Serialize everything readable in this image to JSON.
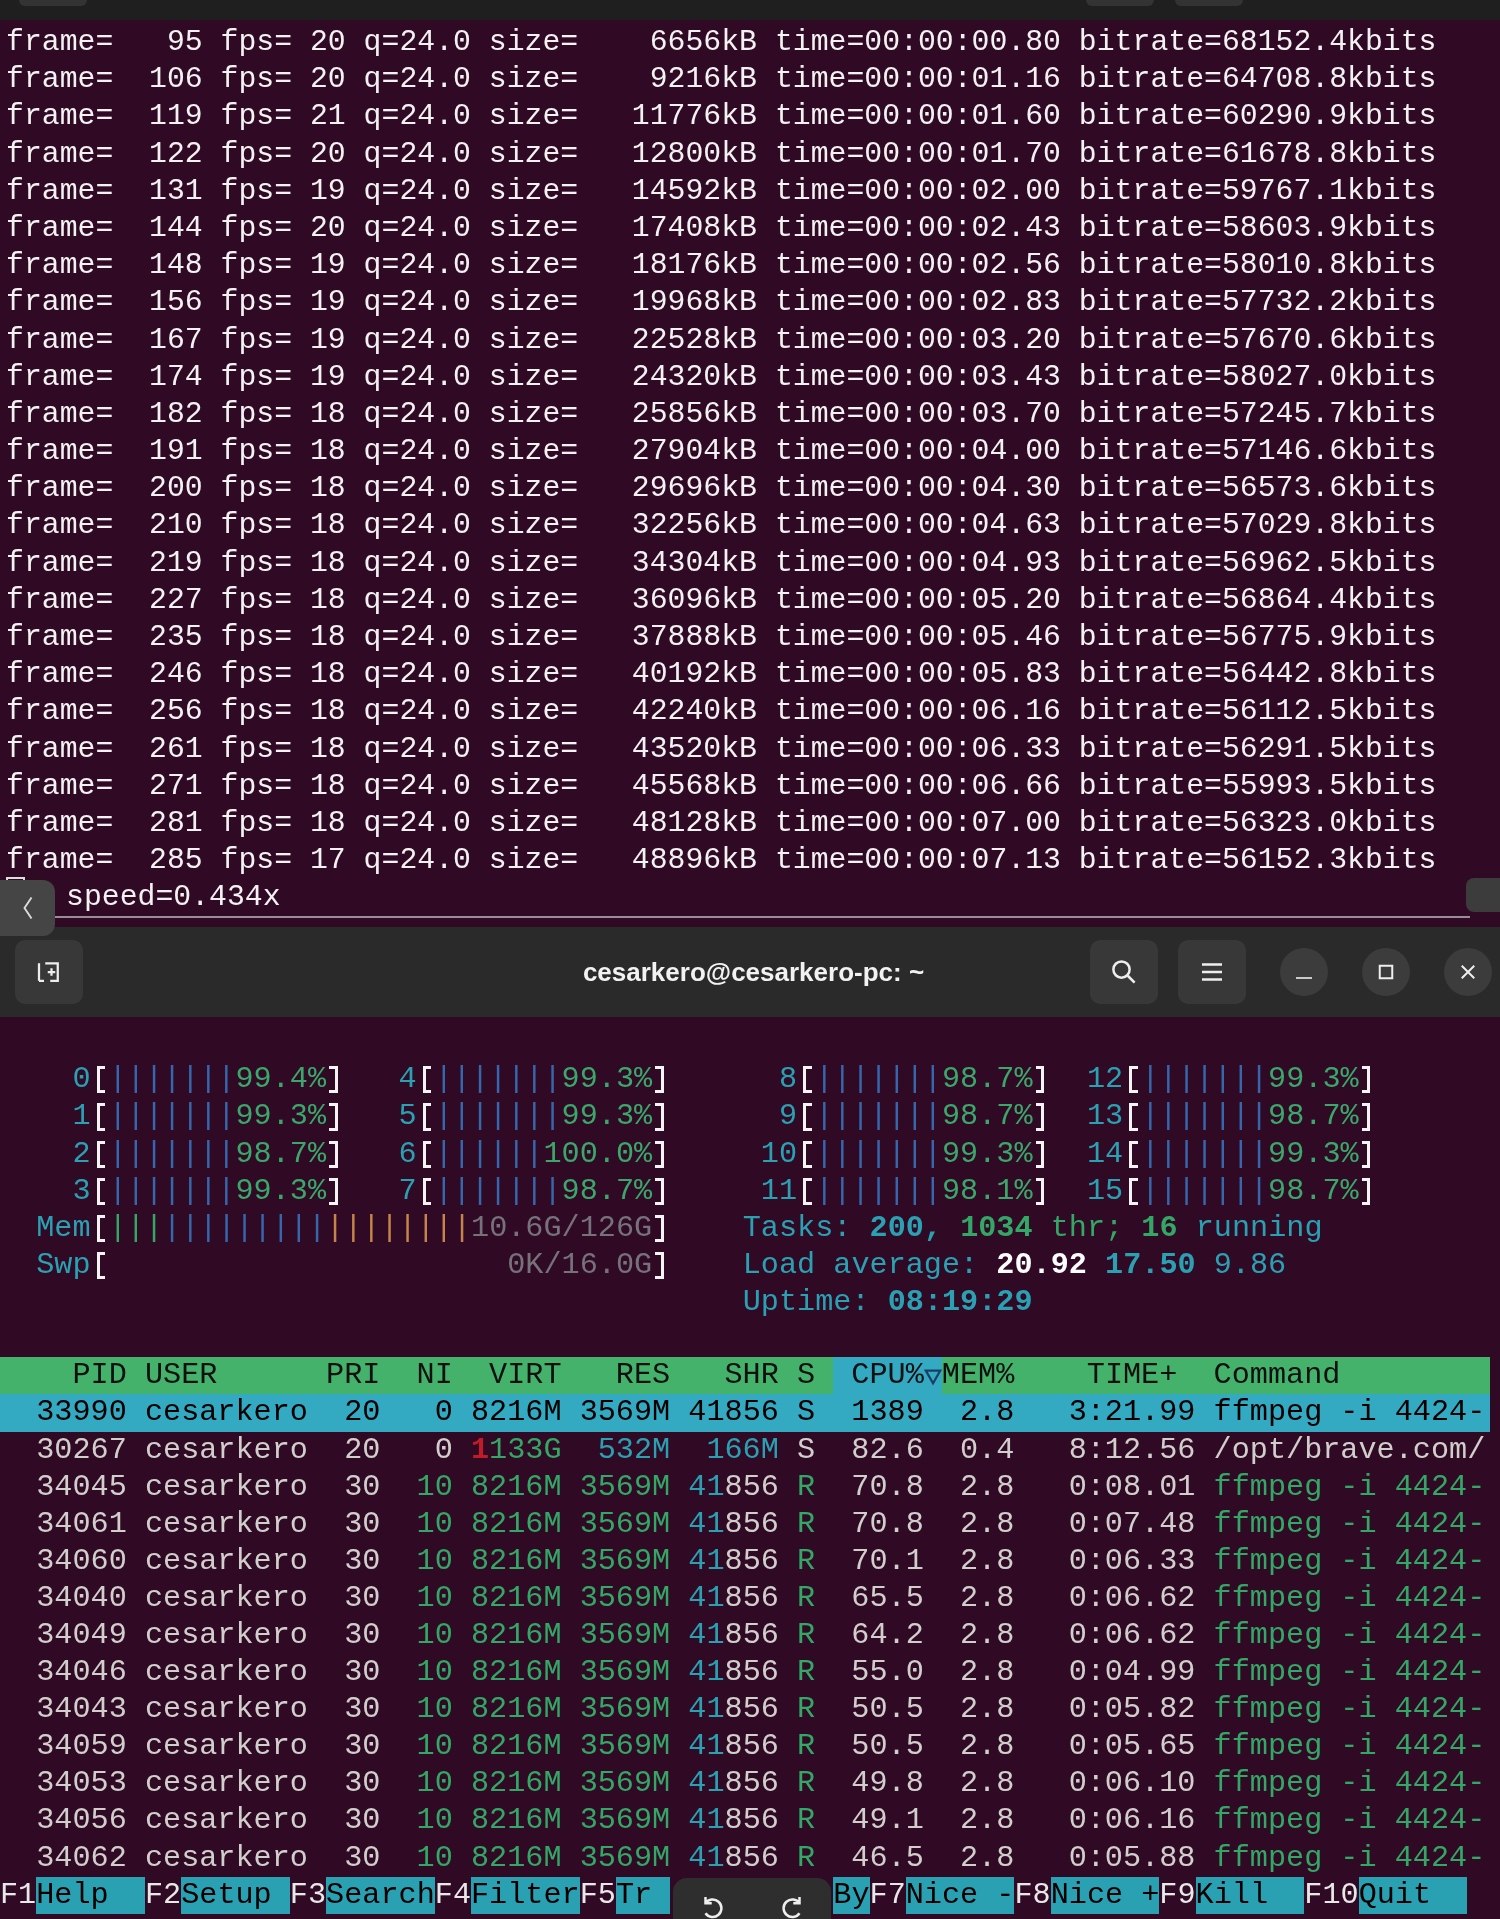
{
  "top_terminal": {
    "lines": [
      "frame=   95 fps= 20 q=24.0 size=    6656kB time=00:00:00.80 bitrate=68152.4kbits",
      "frame=  106 fps= 20 q=24.0 size=    9216kB time=00:00:01.16 bitrate=64708.8kbits",
      "frame=  119 fps= 21 q=24.0 size=   11776kB time=00:00:01.60 bitrate=60290.9kbits",
      "frame=  122 fps= 20 q=24.0 size=   12800kB time=00:00:01.70 bitrate=61678.8kbits",
      "frame=  131 fps= 19 q=24.0 size=   14592kB time=00:00:02.00 bitrate=59767.1kbits",
      "frame=  144 fps= 20 q=24.0 size=   17408kB time=00:00:02.43 bitrate=58603.9kbits",
      "frame=  148 fps= 19 q=24.0 size=   18176kB time=00:00:02.56 bitrate=58010.8kbits",
      "frame=  156 fps= 19 q=24.0 size=   19968kB time=00:00:02.83 bitrate=57732.2kbits",
      "frame=  167 fps= 19 q=24.0 size=   22528kB time=00:00:03.20 bitrate=57670.6kbits",
      "frame=  174 fps= 19 q=24.0 size=   24320kB time=00:00:03.43 bitrate=58027.0kbits",
      "frame=  182 fps= 18 q=24.0 size=   25856kB time=00:00:03.70 bitrate=57245.7kbits",
      "frame=  191 fps= 18 q=24.0 size=   27904kB time=00:00:04.00 bitrate=57146.6kbits",
      "frame=  200 fps= 18 q=24.0 size=   29696kB time=00:00:04.30 bitrate=56573.6kbits",
      "frame=  210 fps= 18 q=24.0 size=   32256kB time=00:00:04.63 bitrate=57029.8kbits",
      "frame=  219 fps= 18 q=24.0 size=   34304kB time=00:00:04.93 bitrate=56962.5kbits",
      "frame=  227 fps= 18 q=24.0 size=   36096kB time=00:00:05.20 bitrate=56864.4kbits",
      "frame=  235 fps= 18 q=24.0 size=   37888kB time=00:00:05.46 bitrate=56775.9kbits",
      "frame=  246 fps= 18 q=24.0 size=   40192kB time=00:00:05.83 bitrate=56442.8kbits",
      "frame=  256 fps= 18 q=24.0 size=   42240kB time=00:00:06.16 bitrate=56112.5kbits",
      "frame=  261 fps= 18 q=24.0 size=   43520kB time=00:00:06.33 bitrate=56291.5kbits",
      "frame=  271 fps= 18 q=24.0 size=   45568kB time=00:00:06.66 bitrate=55993.5kbits",
      "frame=  281 fps= 18 q=24.0 size=   48128kB time=00:00:07.00 bitrate=56323.0kbits",
      "frame=  285 fps= 17 q=24.0 size=   48896kB time=00:00:07.13 bitrate=56152.3kbits"
    ],
    "speed": "speed=0.434x"
  },
  "title_bar": {
    "title": "cesarkero@cesarkero-pc: ~"
  },
  "htop": {
    "cpus": [
      {
        "label": "0",
        "bars": "|||||||",
        "reading": "99.4%"
      },
      {
        "label": "1",
        "bars": "|||||||",
        "reading": "99.3%"
      },
      {
        "label": "2",
        "bars": "|||||||",
        "reading": "98.7%"
      },
      {
        "label": "3",
        "bars": "|||||||",
        "reading": "99.3%"
      },
      {
        "label": "4",
        "bars": "|||||||",
        "reading": "99.3%"
      },
      {
        "label": "5",
        "bars": "|||||||",
        "reading": "99.3%"
      },
      {
        "label": "6",
        "bars": "||||||",
        "reading": "100.0%"
      },
      {
        "label": "7",
        "bars": "|||||||",
        "reading": "98.7%"
      },
      {
        "label": "8",
        "bars": "|||||||",
        "reading": "98.7%"
      },
      {
        "label": "9",
        "bars": "|||||||",
        "reading": "98.7%"
      },
      {
        "label": "10",
        "bars": "|||||||",
        "reading": "99.3%"
      },
      {
        "label": "11",
        "bars": "|||||||",
        "reading": "98.1%"
      },
      {
        "label": "12",
        "bars": "|||||||",
        "reading": "99.3%"
      },
      {
        "label": "13",
        "bars": "|||||||",
        "reading": "98.7%"
      },
      {
        "label": "14",
        "bars": "|||||||",
        "reading": "99.3%"
      },
      {
        "label": "15",
        "bars": "|||||||",
        "reading": "98.7%"
      }
    ],
    "memory": {
      "label": "Mem",
      "segments": [
        {
          "kind": "used",
          "bars": "|||"
        },
        {
          "kind": "buffers",
          "bars": "|||||||||"
        },
        {
          "kind": "cache",
          "bars": "||||||||"
        }
      ],
      "reading": "10.6G/126G"
    },
    "swap": {
      "label": "Swp",
      "reading": "0K/16.0G"
    },
    "tasks": {
      "label": "Tasks:",
      "count": "200,",
      "threads": "1034",
      "threads_unit": "thr;",
      "running": "16",
      "running_unit": "running"
    },
    "load_average": {
      "label": "Load average:",
      "values": [
        "20.92",
        "17.50",
        "9.86"
      ]
    },
    "uptime": {
      "label": "Uptime:",
      "value": "08:19:29"
    },
    "columns": [
      {
        "label": "PID",
        "selected": false
      },
      {
        "label": "USER",
        "selected": false
      },
      {
        "label": "PRI",
        "selected": false
      },
      {
        "label": "NI",
        "selected": false
      },
      {
        "label": "VIRT",
        "selected": false
      },
      {
        "label": "RES",
        "selected": false
      },
      {
        "label": "SHR",
        "selected": false
      },
      {
        "label": "S",
        "selected": false
      },
      {
        "label": "CPU%",
        "selected": true
      },
      {
        "label": "MEM%",
        "selected": false
      },
      {
        "label": "TIME+",
        "selected": false
      },
      {
        "label": "Command",
        "selected": false
      }
    ],
    "rows": [
      {
        "selected": true,
        "kind": "process",
        "pid": "33990",
        "user": "cesarkero",
        "pri": "20",
        "ni": "0",
        "virt": "8216M",
        "res": "3569M",
        "shr": "41856",
        "state": "S",
        "cpu": "1389",
        "mem": "2.8",
        "time": "3:21.99",
        "command": "ffmpeg -i 4424-"
      },
      {
        "selected": false,
        "kind": "process",
        "pid": "30267",
        "user": "cesarkero",
        "pri": "20",
        "ni": "0",
        "virt_high": "1",
        "virt": "133G",
        "res": "532M",
        "shr": "166M",
        "state": "S",
        "cpu": "82.6",
        "mem": "0.4",
        "time": "8:12.56",
        "command": "/opt/brave.com/"
      },
      {
        "selected": false,
        "kind": "thread",
        "pid": "34045",
        "user": "cesarkero",
        "pri": "30",
        "ni": "10",
        "virt": "8216M",
        "res": "3569M",
        "shr_high": "41",
        "shr": "856",
        "state": "R",
        "cpu": "70.8",
        "mem": "2.8",
        "time": "0:08.01",
        "command": "ffmpeg -i 4424-"
      },
      {
        "selected": false,
        "kind": "thread",
        "pid": "34061",
        "user": "cesarkero",
        "pri": "30",
        "ni": "10",
        "virt": "8216M",
        "res": "3569M",
        "shr_high": "41",
        "shr": "856",
        "state": "R",
        "cpu": "70.8",
        "mem": "2.8",
        "time": "0:07.48",
        "command": "ffmpeg -i 4424-"
      },
      {
        "selected": false,
        "kind": "thread",
        "pid": "34060",
        "user": "cesarkero",
        "pri": "30",
        "ni": "10",
        "virt": "8216M",
        "res": "3569M",
        "shr_high": "41",
        "shr": "856",
        "state": "R",
        "cpu": "70.1",
        "mem": "2.8",
        "time": "0:06.33",
        "command": "ffmpeg -i 4424-"
      },
      {
        "selected": false,
        "kind": "thread",
        "pid": "34040",
        "user": "cesarkero",
        "pri": "30",
        "ni": "10",
        "virt": "8216M",
        "res": "3569M",
        "shr_high": "41",
        "shr": "856",
        "state": "R",
        "cpu": "65.5",
        "mem": "2.8",
        "time": "0:06.62",
        "command": "ffmpeg -i 4424-"
      },
      {
        "selected": false,
        "kind": "thread",
        "pid": "34049",
        "user": "cesarkero",
        "pri": "30",
        "ni": "10",
        "virt": "8216M",
        "res": "3569M",
        "shr_high": "41",
        "shr": "856",
        "state": "R",
        "cpu": "64.2",
        "mem": "2.8",
        "time": "0:06.62",
        "command": "ffmpeg -i 4424-"
      },
      {
        "selected": false,
        "kind": "thread",
        "pid": "34046",
        "user": "cesarkero",
        "pri": "30",
        "ni": "10",
        "virt": "8216M",
        "res": "3569M",
        "shr_high": "41",
        "shr": "856",
        "state": "R",
        "cpu": "55.0",
        "mem": "2.8",
        "time": "0:04.99",
        "command": "ffmpeg -i 4424-"
      },
      {
        "selected": false,
        "kind": "thread",
        "pid": "34043",
        "user": "cesarkero",
        "pri": "30",
        "ni": "10",
        "virt": "8216M",
        "res": "3569M",
        "shr_high": "41",
        "shr": "856",
        "state": "R",
        "cpu": "50.5",
        "mem": "2.8",
        "time": "0:05.82",
        "command": "ffmpeg -i 4424-"
      },
      {
        "selected": false,
        "kind": "thread",
        "pid": "34059",
        "user": "cesarkero",
        "pri": "30",
        "ni": "10",
        "virt": "8216M",
        "res": "3569M",
        "shr_high": "41",
        "shr": "856",
        "state": "R",
        "cpu": "50.5",
        "mem": "2.8",
        "time": "0:05.65",
        "command": "ffmpeg -i 4424-"
      },
      {
        "selected": false,
        "kind": "thread",
        "pid": "34053",
        "user": "cesarkero",
        "pri": "30",
        "ni": "10",
        "virt": "8216M",
        "res": "3569M",
        "shr_high": "41",
        "shr": "856",
        "state": "R",
        "cpu": "49.8",
        "mem": "2.8",
        "time": "0:06.10",
        "command": "ffmpeg -i 4424-"
      },
      {
        "selected": false,
        "kind": "thread",
        "pid": "34056",
        "user": "cesarkero",
        "pri": "30",
        "ni": "10",
        "virt": "8216M",
        "res": "3569M",
        "shr_high": "41",
        "shr": "856",
        "state": "R",
        "cpu": "49.1",
        "mem": "2.8",
        "time": "0:06.16",
        "command": "ffmpeg -i 4424-"
      },
      {
        "selected": false,
        "kind": "thread",
        "pid": "34062",
        "user": "cesarkero",
        "pri": "30",
        "ni": "10",
        "virt": "8216M",
        "res": "3569M",
        "shr_high": "41",
        "shr": "856",
        "state": "R",
        "cpu": "46.5",
        "mem": "2.8",
        "time": "0:05.88",
        "command": "ffmpeg -i 4424-"
      }
    ],
    "function_keys": [
      {
        "kind": "full",
        "key": "F1",
        "label": "Help"
      },
      {
        "kind": "full",
        "key": "F2",
        "label": "Setup"
      },
      {
        "kind": "full",
        "key": "F3",
        "label": "Search"
      },
      {
        "kind": "full",
        "key": "F4",
        "label": "Filter"
      },
      {
        "kind": "full",
        "key": "F5",
        "label": "Tr"
      },
      {
        "kind": "partial",
        "label": "By"
      },
      {
        "kind": "full",
        "key": "F7",
        "label": "Nice -"
      },
      {
        "kind": "full",
        "key": "F8",
        "label": "Nice +"
      },
      {
        "kind": "full",
        "key": "F9",
        "label": "Kill"
      },
      {
        "kind": "full",
        "key": "F10",
        "label": "Quit"
      }
    ]
  }
}
